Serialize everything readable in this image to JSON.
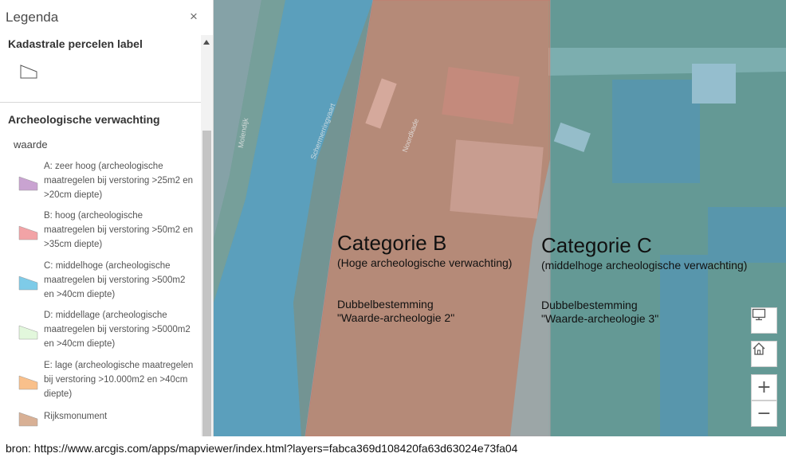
{
  "legend": {
    "title": "Legenda",
    "close_icon": "×",
    "section1": {
      "title": "Kadastrale percelen label"
    },
    "section2": {
      "title": "Archeologische verwachting",
      "field": "waarde",
      "items": [
        {
          "label": "A: zeer hoog (archeologische maatregelen bij verstoring >25m2 en >20cm diepte)",
          "color": "#c9a3d1"
        },
        {
          "label": "B: hoog (archeologische maatregelen bij verstoring >50m2 en >35cm diepte)",
          "color": "#f2a3a6"
        },
        {
          "label": "C: middelhoge (archeologische maatregelen bij verstoring >500m2 en >40cm diepte)",
          "color": "#7ecbe8"
        },
        {
          "label": "D: middellage (archeologische maatregelen bij verstoring >5000m2 en >40cm diepte)",
          "color": "#e2f7dc"
        },
        {
          "label": "E: lage (archeologische maatregelen bij verstoring >10.000m2 en >40cm diepte)",
          "color": "#f9c08b"
        },
        {
          "label": "Rijksmonument",
          "color": "#d8b095"
        }
      ]
    }
  },
  "map": {
    "street_labels": {
      "molendijk": "Molendijk",
      "schermerringvaart": "Schermerringvaart",
      "noordkade": "Noordkade"
    },
    "category_b": {
      "title": "Categorie B",
      "subtitle": "(Hoge archeologische verwachting)",
      "line1": "Dubbelbestemming",
      "line2": "\"Waarde-archeologie 2\""
    },
    "category_c": {
      "title": "Categorie C",
      "subtitle": "(middelhoge archeologische verwachting)",
      "line1": "Dubbelbestemming",
      "line2": "\"Waarde-archeologie 3\""
    },
    "controls": {
      "monitor_icon": "monitor-icon",
      "home_icon": "home-icon",
      "zoom_in": "+",
      "zoom_out": "−"
    },
    "colors": {
      "zone_b": "#e8a090",
      "zone_c": "#7fc8e0"
    }
  },
  "footer": {
    "source": "bron: https://www.arcgis.com/apps/mapviewer/index.html?layers=fabca369d108420fa63d63024e73fa04"
  }
}
